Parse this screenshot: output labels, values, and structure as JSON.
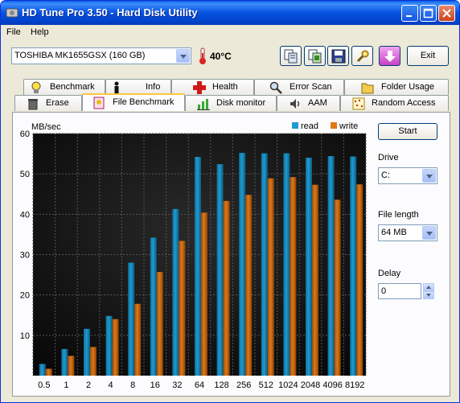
{
  "window": {
    "title": "HD Tune Pro 3.50 - Hard Disk Utility"
  },
  "menu": {
    "file": "File",
    "help": "Help"
  },
  "toolbar": {
    "drive": "TOSHIBA MK1655GSX (160 GB)",
    "temperature": "40°C",
    "exit_label": "Exit"
  },
  "tabs_row1": [
    "Benchmark",
    "Info",
    "Health",
    "Error Scan",
    "Folder Usage"
  ],
  "tabs_row2": [
    "Erase",
    "File Benchmark",
    "Disk monitor",
    "AAM",
    "Random Access"
  ],
  "side": {
    "start_label": "Start",
    "drive_label": "Drive",
    "drive_value": "C:",
    "file_length_label": "File length",
    "file_length_value": "64 MB",
    "delay_label": "Delay",
    "delay_value": "0"
  },
  "colors": {
    "read": "#1e9bd0",
    "write": "#e07818",
    "plot_bg": "#000000"
  },
  "chart_data": {
    "type": "bar",
    "ylabel": "MB/sec",
    "ylim": [
      0,
      60
    ],
    "yticks": [
      10,
      20,
      30,
      40,
      50,
      60
    ],
    "categories": [
      "0.5",
      "1",
      "2",
      "4",
      "8",
      "16",
      "32",
      "64",
      "128",
      "256",
      "512",
      "1024",
      "2048",
      "4096",
      "8192"
    ],
    "series": [
      {
        "name": "read",
        "values": [
          2.9,
          6.6,
          11.6,
          14.8,
          28.0,
          34.2,
          41.3,
          54.2,
          52.4,
          55.2,
          55.1,
          55.1,
          54.0,
          54.4,
          54.3
        ]
      },
      {
        "name": "write",
        "values": [
          1.7,
          4.9,
          7.1,
          14.0,
          17.8,
          25.7,
          33.4,
          40.4,
          43.3,
          44.8,
          48.9,
          49.2,
          47.3,
          43.6,
          47.4
        ]
      }
    ]
  }
}
